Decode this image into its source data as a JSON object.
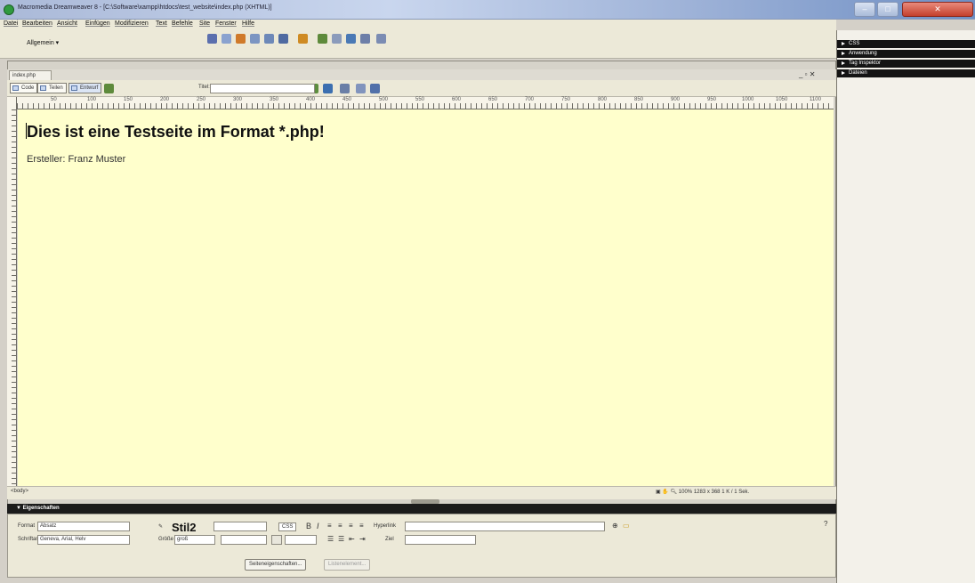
{
  "window": {
    "title": "Macromedia Dreamweaver 8 - [C:\\Software\\xampp\\htdocs\\test_website\\index.php (XHTML)]",
    "colors": {
      "close_button": "#c4402c",
      "design_bg": "#ffffcc"
    }
  },
  "menu": [
    "Datei",
    "Bearbeiten",
    "Ansicht",
    "Einfügen",
    "Modifizieren",
    "Text",
    "Befehle",
    "Site",
    "Fenster",
    "Hilfe"
  ],
  "insert_bar": {
    "category": "Allgemein ▾"
  },
  "document": {
    "tab": "index.php",
    "view_buttons": [
      "Code",
      "Teilen",
      "Entwurf"
    ],
    "title_label": "Titel:",
    "title_value": "",
    "ruler_marks": [
      "50",
      "100",
      "150",
      "200",
      "250",
      "300",
      "350",
      "400",
      "450",
      "500",
      "550",
      "600",
      "650",
      "700",
      "750",
      "800",
      "850",
      "900",
      "950",
      "1000",
      "1050",
      "1100"
    ],
    "heading": "Dies ist eine Testseite im Format *.php!",
    "author": "Ersteller: Franz Muster"
  },
  "status_bar": {
    "tag": "<body>",
    "zoom": "100%",
    "size": "1283 x 368",
    "file_info": "1 K / 1 Sek."
  },
  "properties": {
    "header": "▼ Eigenschaften",
    "format_label": "Format",
    "format_value": "Absatz",
    "font_label": "Schriftart",
    "font_value": "Geneva, Arial, Helv",
    "style_label": "Stil2",
    "size_label": "Größe",
    "size_value": "groß",
    "css_button": "CSS",
    "link_label": "Hyperlink",
    "target_label": "Ziel",
    "page_props_button": "Seiteneigenschaften...",
    "list_item_button": "Listenelement..."
  },
  "right_panels": [
    "CSS",
    "Anwendung",
    "Tag Inspektor",
    "Dateien"
  ]
}
